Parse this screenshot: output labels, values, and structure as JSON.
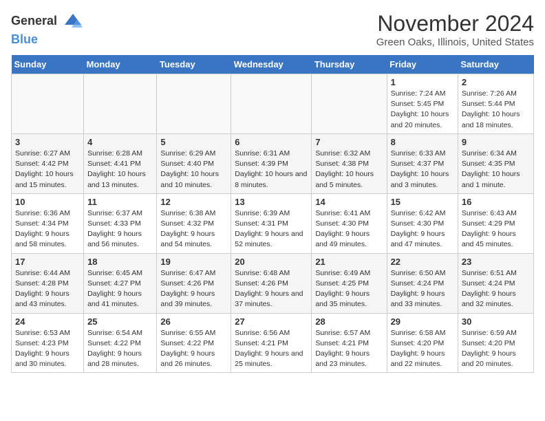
{
  "header": {
    "logo_general": "General",
    "logo_blue": "Blue",
    "month_title": "November 2024",
    "location": "Green Oaks, Illinois, United States"
  },
  "weekdays": [
    "Sunday",
    "Monday",
    "Tuesday",
    "Wednesday",
    "Thursday",
    "Friday",
    "Saturday"
  ],
  "weeks": [
    [
      {
        "day": "",
        "info": ""
      },
      {
        "day": "",
        "info": ""
      },
      {
        "day": "",
        "info": ""
      },
      {
        "day": "",
        "info": ""
      },
      {
        "day": "",
        "info": ""
      },
      {
        "day": "1",
        "info": "Sunrise: 7:24 AM\nSunset: 5:45 PM\nDaylight: 10 hours and 20 minutes."
      },
      {
        "day": "2",
        "info": "Sunrise: 7:26 AM\nSunset: 5:44 PM\nDaylight: 10 hours and 18 minutes."
      }
    ],
    [
      {
        "day": "3",
        "info": "Sunrise: 6:27 AM\nSunset: 4:42 PM\nDaylight: 10 hours and 15 minutes."
      },
      {
        "day": "4",
        "info": "Sunrise: 6:28 AM\nSunset: 4:41 PM\nDaylight: 10 hours and 13 minutes."
      },
      {
        "day": "5",
        "info": "Sunrise: 6:29 AM\nSunset: 4:40 PM\nDaylight: 10 hours and 10 minutes."
      },
      {
        "day": "6",
        "info": "Sunrise: 6:31 AM\nSunset: 4:39 PM\nDaylight: 10 hours and 8 minutes."
      },
      {
        "day": "7",
        "info": "Sunrise: 6:32 AM\nSunset: 4:38 PM\nDaylight: 10 hours and 5 minutes."
      },
      {
        "day": "8",
        "info": "Sunrise: 6:33 AM\nSunset: 4:37 PM\nDaylight: 10 hours and 3 minutes."
      },
      {
        "day": "9",
        "info": "Sunrise: 6:34 AM\nSunset: 4:35 PM\nDaylight: 10 hours and 1 minute."
      }
    ],
    [
      {
        "day": "10",
        "info": "Sunrise: 6:36 AM\nSunset: 4:34 PM\nDaylight: 9 hours and 58 minutes."
      },
      {
        "day": "11",
        "info": "Sunrise: 6:37 AM\nSunset: 4:33 PM\nDaylight: 9 hours and 56 minutes."
      },
      {
        "day": "12",
        "info": "Sunrise: 6:38 AM\nSunset: 4:32 PM\nDaylight: 9 hours and 54 minutes."
      },
      {
        "day": "13",
        "info": "Sunrise: 6:39 AM\nSunset: 4:31 PM\nDaylight: 9 hours and 52 minutes."
      },
      {
        "day": "14",
        "info": "Sunrise: 6:41 AM\nSunset: 4:30 PM\nDaylight: 9 hours and 49 minutes."
      },
      {
        "day": "15",
        "info": "Sunrise: 6:42 AM\nSunset: 4:30 PM\nDaylight: 9 hours and 47 minutes."
      },
      {
        "day": "16",
        "info": "Sunrise: 6:43 AM\nSunset: 4:29 PM\nDaylight: 9 hours and 45 minutes."
      }
    ],
    [
      {
        "day": "17",
        "info": "Sunrise: 6:44 AM\nSunset: 4:28 PM\nDaylight: 9 hours and 43 minutes."
      },
      {
        "day": "18",
        "info": "Sunrise: 6:45 AM\nSunset: 4:27 PM\nDaylight: 9 hours and 41 minutes."
      },
      {
        "day": "19",
        "info": "Sunrise: 6:47 AM\nSunset: 4:26 PM\nDaylight: 9 hours and 39 minutes."
      },
      {
        "day": "20",
        "info": "Sunrise: 6:48 AM\nSunset: 4:26 PM\nDaylight: 9 hours and 37 minutes."
      },
      {
        "day": "21",
        "info": "Sunrise: 6:49 AM\nSunset: 4:25 PM\nDaylight: 9 hours and 35 minutes."
      },
      {
        "day": "22",
        "info": "Sunrise: 6:50 AM\nSunset: 4:24 PM\nDaylight: 9 hours and 33 minutes."
      },
      {
        "day": "23",
        "info": "Sunrise: 6:51 AM\nSunset: 4:24 PM\nDaylight: 9 hours and 32 minutes."
      }
    ],
    [
      {
        "day": "24",
        "info": "Sunrise: 6:53 AM\nSunset: 4:23 PM\nDaylight: 9 hours and 30 minutes."
      },
      {
        "day": "25",
        "info": "Sunrise: 6:54 AM\nSunset: 4:22 PM\nDaylight: 9 hours and 28 minutes."
      },
      {
        "day": "26",
        "info": "Sunrise: 6:55 AM\nSunset: 4:22 PM\nDaylight: 9 hours and 26 minutes."
      },
      {
        "day": "27",
        "info": "Sunrise: 6:56 AM\nSunset: 4:21 PM\nDaylight: 9 hours and 25 minutes."
      },
      {
        "day": "28",
        "info": "Sunrise: 6:57 AM\nSunset: 4:21 PM\nDaylight: 9 hours and 23 minutes."
      },
      {
        "day": "29",
        "info": "Sunrise: 6:58 AM\nSunset: 4:20 PM\nDaylight: 9 hours and 22 minutes."
      },
      {
        "day": "30",
        "info": "Sunrise: 6:59 AM\nSunset: 4:20 PM\nDaylight: 9 hours and 20 minutes."
      }
    ]
  ]
}
